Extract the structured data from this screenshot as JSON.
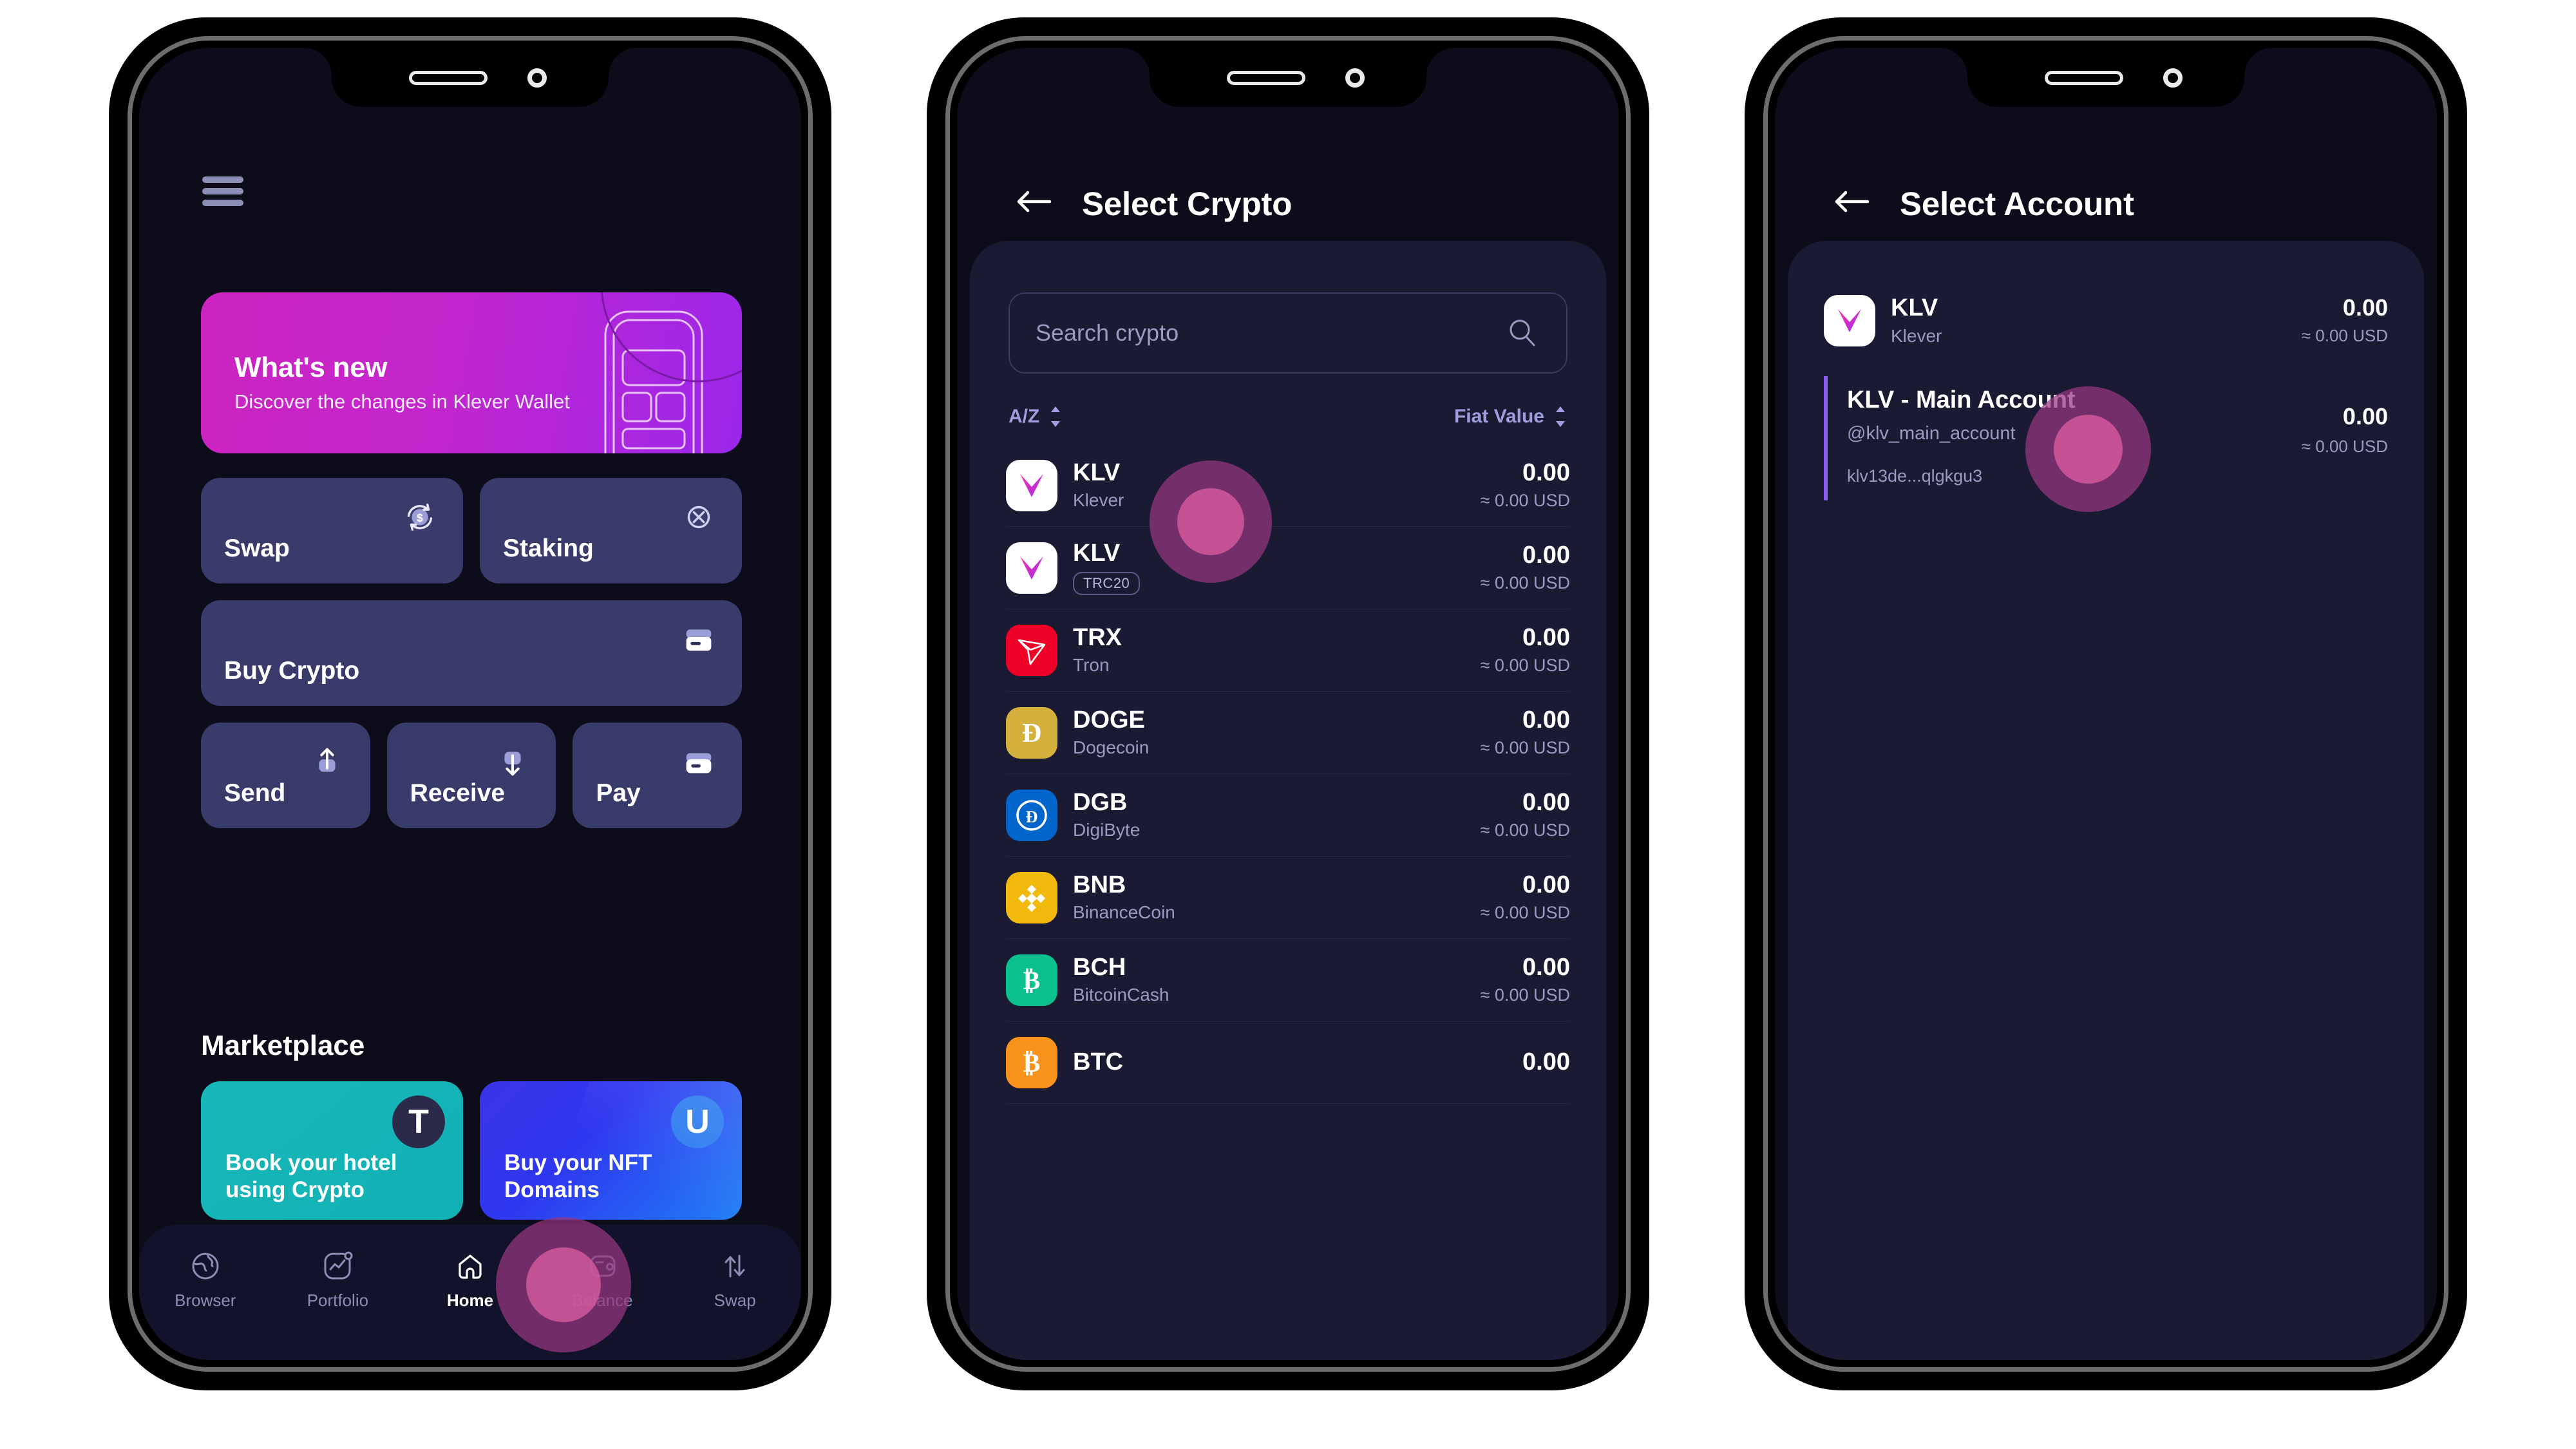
{
  "screens": [
    {
      "id": "home",
      "menu_icon": "hamburger-menu-icon",
      "banner": {
        "title": "What's new",
        "subtitle": "Discover the changes in Klever Wallet"
      },
      "tiles": [
        {
          "label": "Swap",
          "icon": "swap-currency-icon"
        },
        {
          "label": "Staking",
          "icon": "staking-icon"
        },
        {
          "label": "Buy Crypto",
          "icon": "credit-card-icon"
        },
        {
          "label": "Send",
          "icon": "arrow-up-send-icon"
        },
        {
          "label": "Receive",
          "icon": "arrow-down-receive-icon"
        },
        {
          "label": "Pay",
          "icon": "wallet-pay-icon"
        }
      ],
      "marketplace": {
        "title": "Marketplace",
        "cards": [
          {
            "text": "Book your hotel using Crypto",
            "badge": "T",
            "badge_name": "travala-logo"
          },
          {
            "text": "Buy your NFT Domains",
            "badge": "U",
            "badge_name": "unstoppable-domains-logo"
          }
        ]
      },
      "nav": [
        {
          "label": "Browser",
          "icon": "globe-icon",
          "active": false
        },
        {
          "label": "Portfolio",
          "icon": "chart-portfolio-icon",
          "active": false
        },
        {
          "label": "Home",
          "icon": "home-icon",
          "active": true
        },
        {
          "label": "Balance",
          "icon": "wallet-balance-icon",
          "active": false
        },
        {
          "label": "Swap",
          "icon": "swap-arrows-icon",
          "active": false
        }
      ]
    },
    {
      "id": "select-crypto",
      "back_icon": "back-arrow-icon",
      "title": "Select Crypto",
      "search": {
        "placeholder": "Search crypto",
        "icon": "search-icon"
      },
      "sort_left": {
        "label": "A/Z",
        "icon": "sort-updown-icon"
      },
      "sort_right": {
        "label": "Fiat Value",
        "icon": "sort-updown-icon"
      },
      "coins": [
        {
          "symbol": "KLV",
          "name": "Klever",
          "chip": "",
          "value": "0.00",
          "usd": "≈ 0.00 USD",
          "color": "#ffffff",
          "logo": "klv-logo"
        },
        {
          "symbol": "KLV",
          "name": "",
          "chip": "TRC20",
          "value": "0.00",
          "usd": "≈ 0.00 USD",
          "color": "#ffffff",
          "logo": "klv-logo"
        },
        {
          "symbol": "TRX",
          "name": "Tron",
          "chip": "",
          "value": "0.00",
          "usd": "≈ 0.00 USD",
          "color": "#ef0027",
          "logo": "tron-logo"
        },
        {
          "symbol": "DOGE",
          "name": "Dogecoin",
          "chip": "",
          "value": "0.00",
          "usd": "≈ 0.00 USD",
          "color": "#d4b13c",
          "logo": "dogecoin-logo"
        },
        {
          "symbol": "DGB",
          "name": "DigiByte",
          "chip": "",
          "value": "0.00",
          "usd": "≈ 0.00 USD",
          "color": "#0066cc",
          "logo": "digibyte-logo"
        },
        {
          "symbol": "BNB",
          "name": "BinanceCoin",
          "chip": "",
          "value": "0.00",
          "usd": "≈ 0.00 USD",
          "color": "#f0b90b",
          "logo": "binance-logo"
        },
        {
          "symbol": "BCH",
          "name": "BitcoinCash",
          "chip": "",
          "value": "0.00",
          "usd": "≈ 0.00 USD",
          "color": "#0ac18e",
          "logo": "bitcoincash-logo"
        },
        {
          "symbol": "BTC",
          "name": "",
          "chip": "",
          "value": "0.00",
          "usd": "",
          "color": "#f7931a",
          "logo": "bitcoin-logo"
        }
      ]
    },
    {
      "id": "select-account",
      "back_icon": "back-arrow-icon",
      "title": "Select Account",
      "asset": {
        "symbol": "KLV",
        "name": "Klever",
        "value": "0.00",
        "usd": "≈ 0.00 USD",
        "logo": "klv-logo"
      },
      "account": {
        "title": "KLV - Main Account",
        "handle": "@klv_main_account",
        "address": "klv13de...qlgkgu3",
        "value": "0.00",
        "usd": "≈ 0.00 USD"
      }
    }
  ],
  "colors": {
    "screen_bg": "#0c0c1b",
    "sheet_bg": "#1a1a33",
    "tile_bg": "#393c6b",
    "accent_purple": "#8b5cf6",
    "muted_text": "#9a9bc0",
    "touch_highlight": "#d65a9f"
  }
}
